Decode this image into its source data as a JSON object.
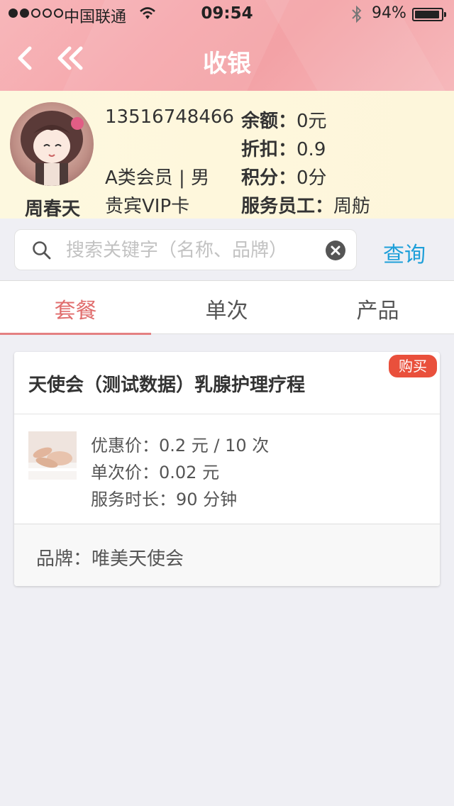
{
  "status_bar": {
    "carrier": "中国联通",
    "time": "09:54",
    "battery": "94%",
    "battery_level": 0.94
  },
  "nav": {
    "title": "收银"
  },
  "member": {
    "name": "周春天",
    "phone": "13516748466",
    "level_gender": "A类会员 | 男",
    "card_type": "贵宾VIP卡",
    "balance_label": "余额：",
    "balance_value": "0元",
    "discount_label": "折扣：",
    "discount_value": "0.9",
    "points_label": "积分：",
    "points_value": "0分",
    "staff_label": "服务员工：",
    "staff_value": "周舫"
  },
  "search": {
    "placeholder": "搜索关键字（名称、品牌）",
    "value": "",
    "button_label": "查询"
  },
  "tabs": [
    {
      "label": "套餐",
      "active": true
    },
    {
      "label": "单次",
      "active": false
    },
    {
      "label": "产品",
      "active": false
    }
  ],
  "packages": [
    {
      "title": "天使会（测试数据）乳腺护理疗程",
      "badge": "购买",
      "discount_price": "优惠价：0.2 元 / 10 次",
      "single_price": "单次价：0.02 元",
      "duration": "服务时长：90 分钟",
      "brand": "品牌：唯美天使会"
    }
  ],
  "colors": {
    "header": "#f5a8ac",
    "member_bg": "#fdf7dc",
    "accent_tab": "#e06d6d",
    "query_blue": "#1e9fd9",
    "badge_red": "#e9503c"
  }
}
